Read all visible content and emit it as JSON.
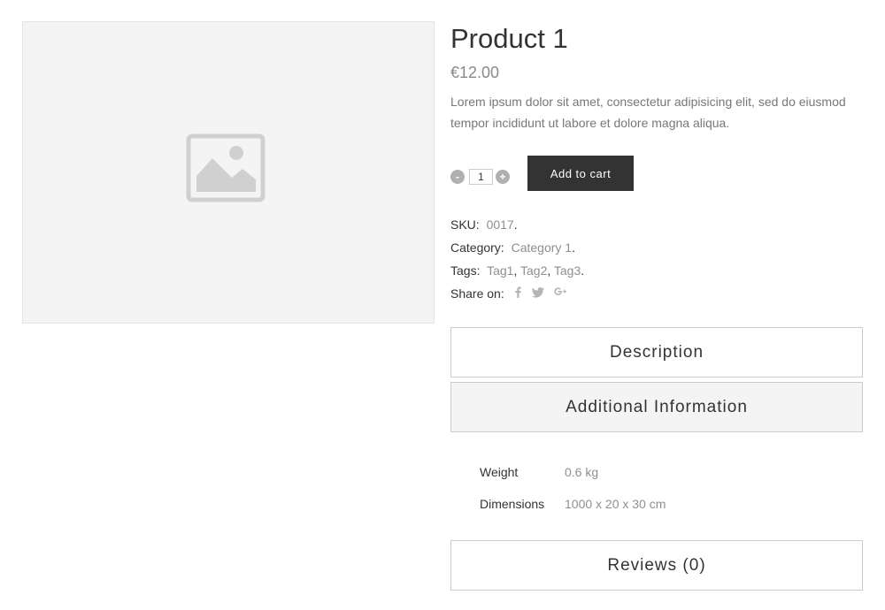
{
  "product": {
    "title": "Product 1",
    "price": "€12.00",
    "description": "Lorem ipsum dolor sit amet, consectetur adipisicing elit, sed do eiusmod tempor incididunt ut labore et dolore magna aliqua."
  },
  "cart": {
    "minus_label": "-",
    "plus_label": "+",
    "quantity": "1",
    "add_label": "Add to cart"
  },
  "meta": {
    "sku_label": "SKU:",
    "sku_value": "0017",
    "category_label": "Category:",
    "category_value": "Category 1",
    "tags_label": "Tags:",
    "tags": [
      "Tag1",
      "Tag2",
      "Tag3"
    ],
    "share_label": "Share on:",
    "share_icons": [
      "facebook-icon",
      "twitter-icon",
      "google-plus-icon"
    ]
  },
  "tabs": {
    "description": "Description",
    "additional": "Additional Information",
    "reviews": "Reviews (0)"
  },
  "attributes": [
    {
      "name": "Weight",
      "value": "0.6 kg"
    },
    {
      "name": "Dimensions",
      "value": "1000 x 20 x 30 cm"
    }
  ],
  "colors": {
    "button_bg": "#333333",
    "active_tab_bg": "#f4f4f4",
    "muted_text": "#8f8f8f"
  }
}
